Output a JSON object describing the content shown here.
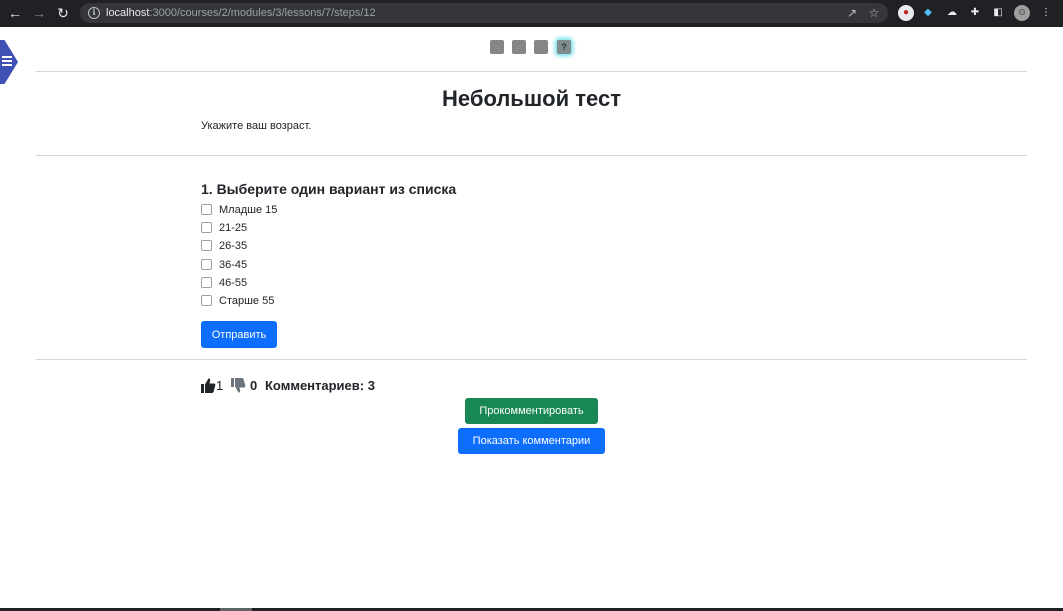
{
  "browser": {
    "url_host": "localhost",
    "url_path": ":3000/courses/2/modules/3/lessons/7/steps/12"
  },
  "steps": {
    "items": [
      "",
      "",
      "",
      "?"
    ]
  },
  "lesson": {
    "title": "Небольшой тест",
    "subtitle": "Укажите ваш возраст."
  },
  "quiz": {
    "question": "1. Выберите один вариант из списка",
    "options": [
      "Младше 15",
      "21-25",
      "26-35",
      "36-45",
      "46-55",
      "Старше 55"
    ],
    "submit_label": "Отправить"
  },
  "feedback": {
    "likes": "1",
    "dislikes": "0",
    "comments_label": "Комментариев: 3",
    "comment_button": "Прокомментировать",
    "show_comments_button": "Показать комментарии"
  },
  "colors": {
    "primary": "#0d6efd",
    "success": "#198754",
    "sidebar": "#3f51b5",
    "step_active_glow": "#6fe0e8"
  }
}
